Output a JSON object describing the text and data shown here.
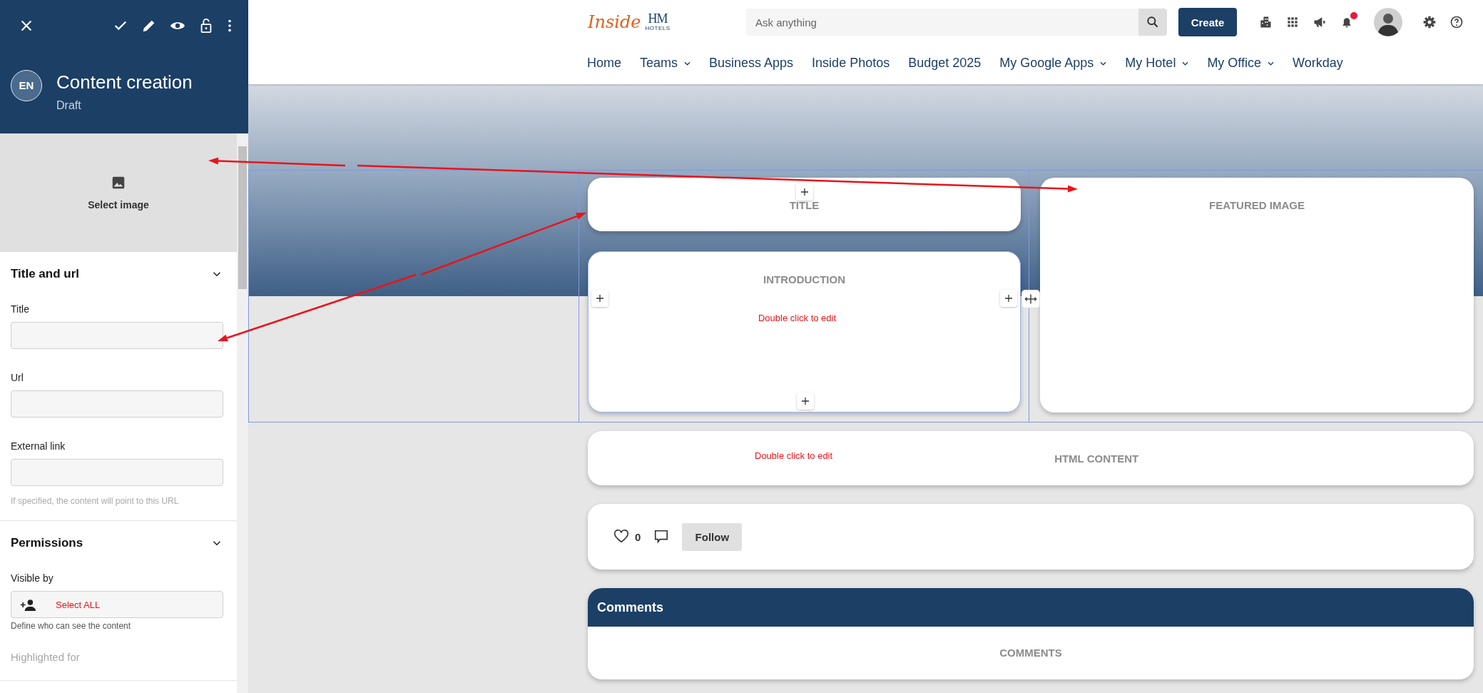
{
  "panel": {
    "avatar": "EN",
    "title": "Content creation",
    "status": "Draft",
    "image_picker": {
      "label": "Select image"
    },
    "sections": [
      {
        "title": "Title and url",
        "expanded": true,
        "fields": [
          {
            "kind": "input",
            "label": "Title"
          },
          {
            "kind": "input",
            "label": "Url"
          },
          {
            "kind": "input",
            "label": "External link",
            "hint": "If specified, the content will point to this URL"
          }
        ]
      },
      {
        "title": "Permissions",
        "expanded": true,
        "fields": [
          {
            "kind": "picker",
            "label": "Visible by",
            "value": "Select ALL",
            "hint": "Define who can see the content"
          },
          {
            "kind": "caption",
            "label": "Highlighted for"
          }
        ]
      }
    ]
  },
  "header": {
    "logo": {
      "script": "Inside",
      "mark": "HM",
      "caption": "HOTELS"
    },
    "search": {
      "placeholder": "Ask anything"
    },
    "create_button": "Create",
    "notifications": {
      "unread": true
    },
    "nav": [
      {
        "label": "Home",
        "has_menu": false
      },
      {
        "label": "Teams",
        "has_menu": true
      },
      {
        "label": "Business Apps",
        "has_menu": false
      },
      {
        "label": "Inside Photos",
        "has_menu": false
      },
      {
        "label": "Budget 2025",
        "has_menu": false
      },
      {
        "label": "My Google Apps",
        "has_menu": true
      },
      {
        "label": "My Hotel",
        "has_menu": true
      },
      {
        "label": "My Office",
        "has_menu": true
      },
      {
        "label": "Workday",
        "has_menu": false
      }
    ]
  },
  "canvas": {
    "title_block": "TITLE",
    "featured_block": "FEATURED IMAGE",
    "intro_block": {
      "label": "INTRODUCTION",
      "hint": "Double click to edit"
    },
    "html_block": {
      "label": "HTML CONTENT",
      "hint": "Double click to edit"
    },
    "social": {
      "likes": "0",
      "follow": "Follow"
    },
    "comments": {
      "title": "Comments",
      "label": "COMMENTS"
    }
  }
}
